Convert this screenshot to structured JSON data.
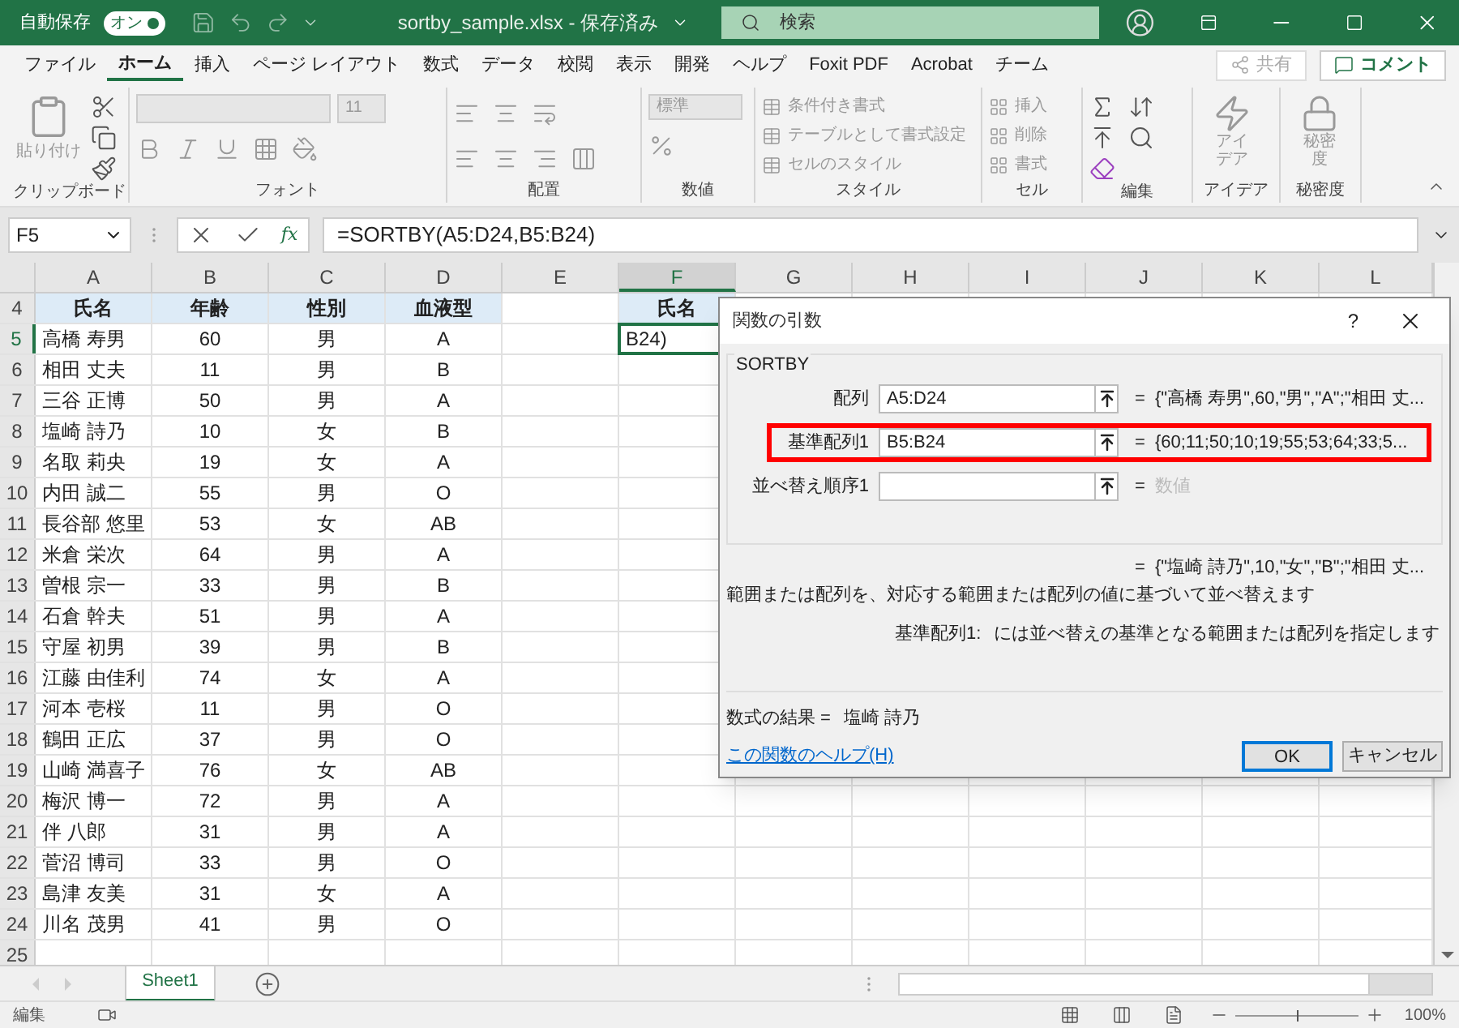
{
  "title_bar": {
    "autosave_label": "自動保存",
    "autosave": {
      "label": "オン",
      "on": true
    },
    "filename": "sortby_sample.xlsx - 保存済み",
    "search_placeholder": "検索"
  },
  "menu_tabs": [
    {
      "label": "ファイル",
      "selected": false
    },
    {
      "label": "ホーム",
      "selected": true
    },
    {
      "label": "挿入",
      "selected": false
    },
    {
      "label": "ページ レイアウト",
      "selected": false
    },
    {
      "label": "数式",
      "selected": false
    },
    {
      "label": "データ",
      "selected": false
    },
    {
      "label": "校閲",
      "selected": false
    },
    {
      "label": "表示",
      "selected": false
    },
    {
      "label": "開発",
      "selected": false
    },
    {
      "label": "ヘルプ",
      "selected": false
    },
    {
      "label": "Foxit PDF",
      "selected": false
    },
    {
      "label": "Acrobat",
      "selected": false
    },
    {
      "label": "チーム",
      "selected": false
    }
  ],
  "share_button": "共有",
  "comment_button": "コメント",
  "ribbon": {
    "clipboard": {
      "paste_label": "貼り付け",
      "group_label": "クリップボード"
    },
    "font": {
      "size": "11",
      "group_label": "フォント"
    },
    "alignment": {
      "group_label": "配置"
    },
    "number": {
      "format": "標準",
      "group_label": "数値"
    },
    "styles": {
      "items": [
        "条件付き書式",
        "テーブルとして書式設定",
        "セルのスタイル"
      ],
      "group_label": "スタイル"
    },
    "cells": {
      "items": [
        "挿入",
        "削除",
        "書式"
      ],
      "group_label": "セル"
    },
    "editing": {
      "group_label": "編集"
    },
    "ideas": {
      "button_label": "アイデア",
      "group_label": "アイデア"
    },
    "sensitivity": {
      "button_label": "秘密度",
      "group_label": "秘密度"
    }
  },
  "name_box": "F5",
  "function_symbol": "fx",
  "formula": "=SORTBY(A5:D24,B5:B24)",
  "columns": [
    {
      "label": "A",
      "selected": false
    },
    {
      "label": "B",
      "selected": false
    },
    {
      "label": "C",
      "selected": false
    },
    {
      "label": "D",
      "selected": false
    },
    {
      "label": "E",
      "selected": false
    },
    {
      "label": "F",
      "selected": true
    },
    {
      "label": "G",
      "selected": false
    },
    {
      "label": "H",
      "selected": false
    },
    {
      "label": "I",
      "selected": false
    },
    {
      "label": "J",
      "selected": false
    },
    {
      "label": "K",
      "selected": false
    },
    {
      "label": "L",
      "selected": false
    }
  ],
  "rows": [
    {
      "number": "4",
      "selected": false,
      "header": true,
      "cells": [
        "氏名",
        "年齢",
        "性別",
        "血液型",
        "",
        "氏名"
      ]
    },
    {
      "number": "5",
      "selected": true,
      "header": false,
      "cells": [
        "高橋 寿男",
        "60",
        "男",
        "A",
        "",
        "B24)"
      ]
    },
    {
      "number": "6",
      "selected": false,
      "header": false,
      "cells": [
        "相田 丈夫",
        "11",
        "男",
        "B"
      ]
    },
    {
      "number": "7",
      "selected": false,
      "header": false,
      "cells": [
        "三谷 正博",
        "50",
        "男",
        "A"
      ]
    },
    {
      "number": "8",
      "selected": false,
      "header": false,
      "cells": [
        "塩崎 詩乃",
        "10",
        "女",
        "B"
      ]
    },
    {
      "number": "9",
      "selected": false,
      "header": false,
      "cells": [
        "名取 莉央",
        "19",
        "女",
        "A"
      ]
    },
    {
      "number": "10",
      "selected": false,
      "header": false,
      "cells": [
        "内田 誠二",
        "55",
        "男",
        "O"
      ]
    },
    {
      "number": "11",
      "selected": false,
      "header": false,
      "cells": [
        "長谷部 悠里",
        "53",
        "女",
        "AB"
      ]
    },
    {
      "number": "12",
      "selected": false,
      "header": false,
      "cells": [
        "米倉 栄次",
        "64",
        "男",
        "A"
      ]
    },
    {
      "number": "13",
      "selected": false,
      "header": false,
      "cells": [
        "曽根 宗一",
        "33",
        "男",
        "B"
      ]
    },
    {
      "number": "14",
      "selected": false,
      "header": false,
      "cells": [
        "石倉 幹夫",
        "51",
        "男",
        "A"
      ]
    },
    {
      "number": "15",
      "selected": false,
      "header": false,
      "cells": [
        "守屋 初男",
        "39",
        "男",
        "B"
      ]
    },
    {
      "number": "16",
      "selected": false,
      "header": false,
      "cells": [
        "江藤 由佳利",
        "74",
        "女",
        "A"
      ]
    },
    {
      "number": "17",
      "selected": false,
      "header": false,
      "cells": [
        "河本 壱桜",
        "11",
        "男",
        "O"
      ]
    },
    {
      "number": "18",
      "selected": false,
      "header": false,
      "cells": [
        "鶴田 正広",
        "37",
        "男",
        "O"
      ]
    },
    {
      "number": "19",
      "selected": false,
      "header": false,
      "cells": [
        "山崎 満喜子",
        "76",
        "女",
        "AB"
      ]
    },
    {
      "number": "20",
      "selected": false,
      "header": false,
      "cells": [
        "梅沢 博一",
        "72",
        "男",
        "A"
      ]
    },
    {
      "number": "21",
      "selected": false,
      "header": false,
      "cells": [
        "伴 八郎",
        "31",
        "男",
        "A"
      ]
    },
    {
      "number": "22",
      "selected": false,
      "header": false,
      "cells": [
        "菅沼 博司",
        "33",
        "男",
        "O"
      ]
    },
    {
      "number": "23",
      "selected": false,
      "header": false,
      "cells": [
        "島津 友美",
        "31",
        "女",
        "A"
      ]
    },
    {
      "number": "24",
      "selected": false,
      "header": false,
      "cells": [
        "川名 茂男",
        "41",
        "男",
        "O"
      ]
    },
    {
      "number": "25",
      "selected": false,
      "header": false,
      "cells": []
    }
  ],
  "dialog": {
    "title": "関数の引数",
    "help": "?",
    "function_name": "SORTBY",
    "args": [
      {
        "label": "配列",
        "value": "A5:D24",
        "result": "{\"高橋 寿男\",60,\"男\",\"A\";\"相田 丈...",
        "highlighted": false,
        "muted": false
      },
      {
        "label": "基準配列1",
        "value": "B5:B24",
        "result": "{60;11;50;10;19;55;53;64;33;5...",
        "highlighted": true,
        "muted": false
      },
      {
        "label": "並べ替え順序1",
        "result": "数値",
        "highlighted": false,
        "muted": true
      }
    ],
    "equals": "=",
    "overall_result": "{\"塩崎 詩乃\",10,\"女\",\"B\";\"相田 丈...",
    "description": "範囲または配列を、対応する範囲または配列の値に基づいて並べ替えます",
    "arg_name": "基準配列1:",
    "arg_description": "には並べ替えの基準となる範囲または配列を指定します",
    "formula_result_label": "数式の結果 =",
    "formula_result": "塩崎 詩乃",
    "help_link": "この関数のヘルプ(H)",
    "ok": "OK",
    "cancel": "キャンセル"
  },
  "sheet_tabs": [
    {
      "label": "Sheet1",
      "selected": true
    }
  ],
  "status": "編集",
  "zoom": {
    "level": 0.5,
    "label": "100%"
  }
}
